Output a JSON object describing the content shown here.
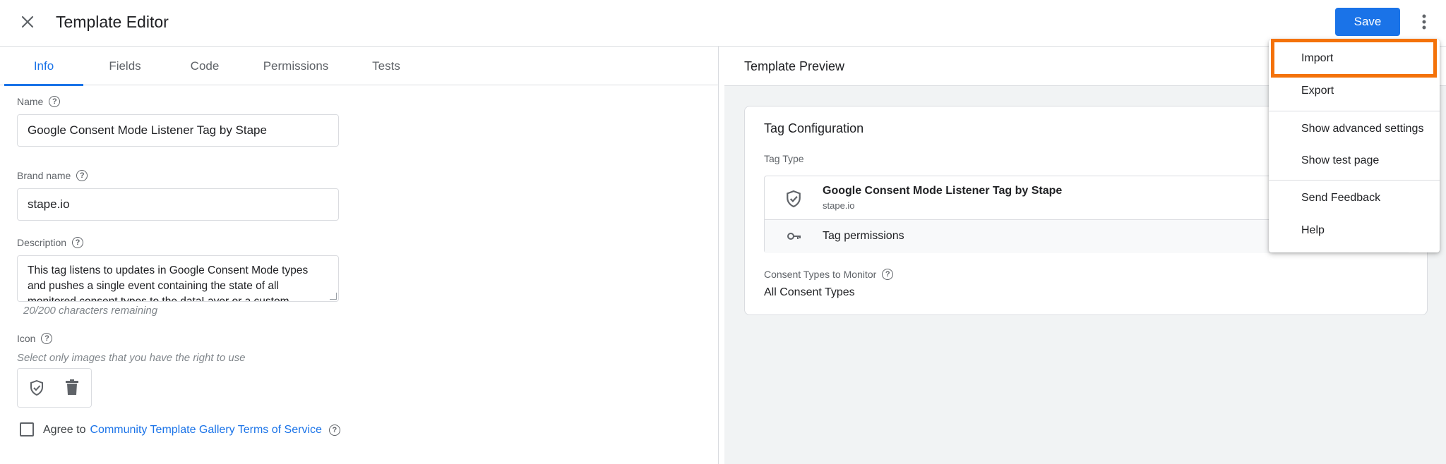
{
  "header": {
    "title": "Template Editor",
    "save_label": "Save",
    "icons": {
      "close": "close-icon",
      "more": "more-vert-icon"
    }
  },
  "tabs": [
    "Info",
    "Fields",
    "Code",
    "Permissions",
    "Tests"
  ],
  "active_tab": "Info",
  "info": {
    "name_label": "Name",
    "name_value": "Google Consent Mode Listener Tag by Stape",
    "brand_label": "Brand name",
    "brand_value": "stape.io",
    "description_label": "Description",
    "description_value": "This tag listens to updates in Google Consent Mode types and pushes a single event containing the state of all monitored consent types to the dataLayer or a custom",
    "chars_remaining": "20/200 characters remaining",
    "icon_label": "Icon",
    "icon_hint": "Select only images that you have the right to use",
    "agree_prefix": "Agree to",
    "agree_link": "Community Template Gallery Terms of Service",
    "agree_checked": false
  },
  "preview": {
    "title": "Template Preview",
    "card_title": "Tag Configuration",
    "tag_type_label": "Tag Type",
    "tag_name": "Google Consent Mode Listener Tag by Stape",
    "tag_brand": "stape.io",
    "tag_permissions": "Tag permissions",
    "consent_label": "Consent Types to Monitor",
    "consent_value": "All Consent Types"
  },
  "menu": {
    "items": [
      "Import",
      "Export",
      "Show advanced settings",
      "Show test page",
      "Send Feedback",
      "Help"
    ],
    "highlighted": "Import"
  },
  "colors": {
    "accent": "#1a73e8",
    "highlight_border": "#f4720a",
    "preview_bg": "#f1f3f4"
  }
}
